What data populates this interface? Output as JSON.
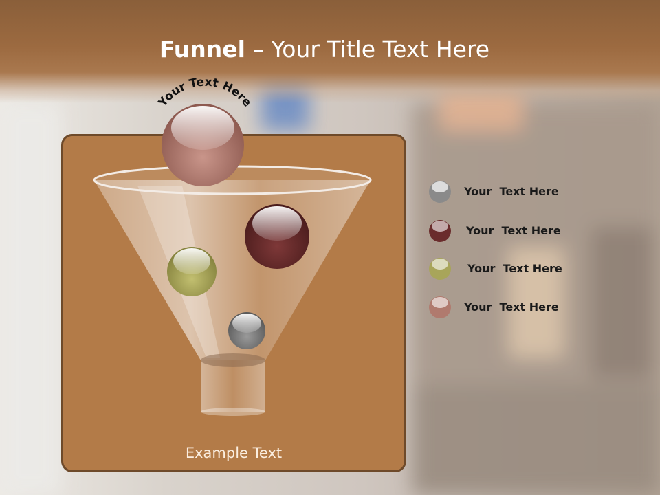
{
  "slide": {
    "title_bold": "Funnel",
    "title_rest": " – Your Title Text Here",
    "curved_label": "Your Text Here",
    "example_text": "Example Text"
  },
  "legend": [
    {
      "label": "Your  Text Here",
      "color": "#8a8a8a"
    },
    {
      "label": "Your  Text Here",
      "color": "#6a2c2c"
    },
    {
      "label": "Your  Text Here",
      "color": "#a8a55a"
    },
    {
      "label": "Your  Text Here",
      "color": "#b07a6e"
    }
  ],
  "balls": [
    {
      "name": "top-ball",
      "color": "#b07a6e"
    },
    {
      "name": "maroon-ball",
      "color": "#6a2c2c"
    },
    {
      "name": "olive-ball",
      "color": "#a8a55a"
    },
    {
      "name": "gray-ball",
      "color": "#8a8a8a"
    }
  ],
  "colors": {
    "title_band": "#9c6a40",
    "panel": "#b37b48",
    "panel_border": "#6e4a2a"
  }
}
